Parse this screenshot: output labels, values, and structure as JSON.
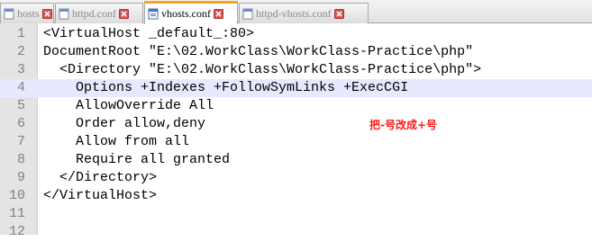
{
  "tabs": [
    {
      "label": "hosts",
      "active": false
    },
    {
      "label": "httpd.conf",
      "active": false
    },
    {
      "label": "vhosts.conf",
      "active": true
    },
    {
      "label": "httpd-vhosts.conf",
      "active": false
    }
  ],
  "editor": {
    "lines": [
      {
        "num": "1",
        "text": "<VirtualHost _default_:80>"
      },
      {
        "num": "2",
        "text": "DocumentRoot \"E:\\02.WorkClass\\WorkClass-Practice\\php\""
      },
      {
        "num": "3",
        "text": "  <Directory \"E:\\02.WorkClass\\WorkClass-Practice\\php\">"
      },
      {
        "num": "4",
        "text": "    Options +Indexes +FollowSymLinks +ExecCGI"
      },
      {
        "num": "5",
        "text": "    AllowOverride All"
      },
      {
        "num": "6",
        "text": "    Order allow,deny"
      },
      {
        "num": "7",
        "text": "    Allow from all"
      },
      {
        "num": "8",
        "text": "    Require all granted"
      },
      {
        "num": "9",
        "text": "  </Directory>"
      },
      {
        "num": "10",
        "text": "</VirtualHost>"
      },
      {
        "num": "11",
        "text": ""
      },
      {
        "num": "12",
        "text": ""
      }
    ],
    "current_line": 4,
    "annotation": "把-号改成+号"
  },
  "colors": {
    "active_tab_accent": "#f7a428",
    "current_line_bg": "#e8e8ff",
    "annotation": "#ff1a1a",
    "close_icon": "#d9534f"
  }
}
